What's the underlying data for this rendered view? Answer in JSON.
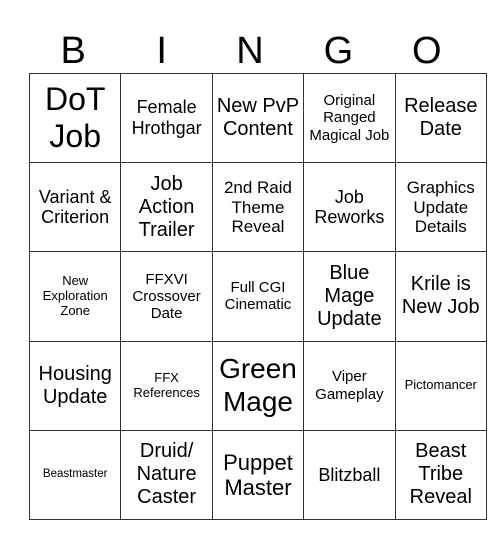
{
  "header": [
    "B",
    "I",
    "N",
    "G",
    "O"
  ],
  "rows": [
    [
      "DoT Job",
      "Female Hrothgar",
      "New PvP Content",
      "Original Ranged Magical Job",
      "Release Date"
    ],
    [
      "Variant & Criterion",
      "Job Action Trailer",
      "2nd Raid Theme Reveal",
      "Job Reworks",
      "Graphics Update Details"
    ],
    [
      "New Exploration Zone",
      "FFXVI Crossover Date",
      "Full CGI Cinematic",
      "Blue Mage Update",
      "Krile is New Job"
    ],
    [
      "Housing Update",
      "FFX References",
      "Green Mage",
      "Viper Gameplay",
      "Pictomancer"
    ],
    [
      "Beastmaster",
      "Druid/ Nature Caster",
      "Puppet Master",
      "Blitzball",
      "Beast Tribe Reveal"
    ]
  ]
}
